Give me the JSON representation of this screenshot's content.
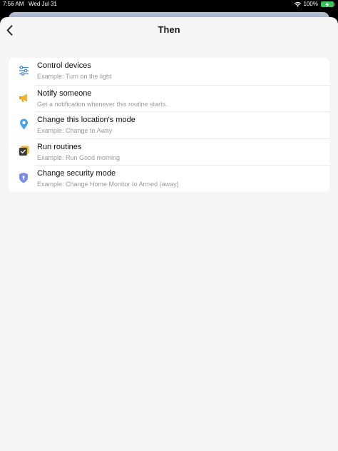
{
  "status_bar": {
    "time": "7:56 AM",
    "date": "Wed Jul 31",
    "battery": "100%",
    "icons": [
      "wifi-icon",
      "battery-charging-icon"
    ]
  },
  "header": {
    "title": "Then",
    "back_icon": "chevron-left-icon"
  },
  "actions": [
    {
      "icon": "sliders-icon",
      "title": "Control devices",
      "subtitle": "Example: Turn on the light"
    },
    {
      "icon": "megaphone-icon",
      "title": "Notify someone",
      "subtitle": "Get a notification whenever this routine starts."
    },
    {
      "icon": "location-pin-icon",
      "title": "Change this location's mode",
      "subtitle": "Example: Change to Away"
    },
    {
      "icon": "routine-check-icon",
      "title": "Run routines",
      "subtitle": "Example: Run Good morning"
    },
    {
      "icon": "shield-icon",
      "title": "Change security mode",
      "subtitle": "Example: Change Home Monitor to Armed (away)"
    }
  ],
  "colors": {
    "sheet_background": "#f5f5f5",
    "card_background": "#ffffff",
    "sliders_icon": "#3d8be0",
    "megaphone_icon": "#f2b52a",
    "pin_icon": "#4aa3e8",
    "routine_icon": "#3a3a3a",
    "routine_icon_accent": "#f2b52a",
    "shield_icon": "#7d8ee8",
    "battery": "#34c759"
  }
}
